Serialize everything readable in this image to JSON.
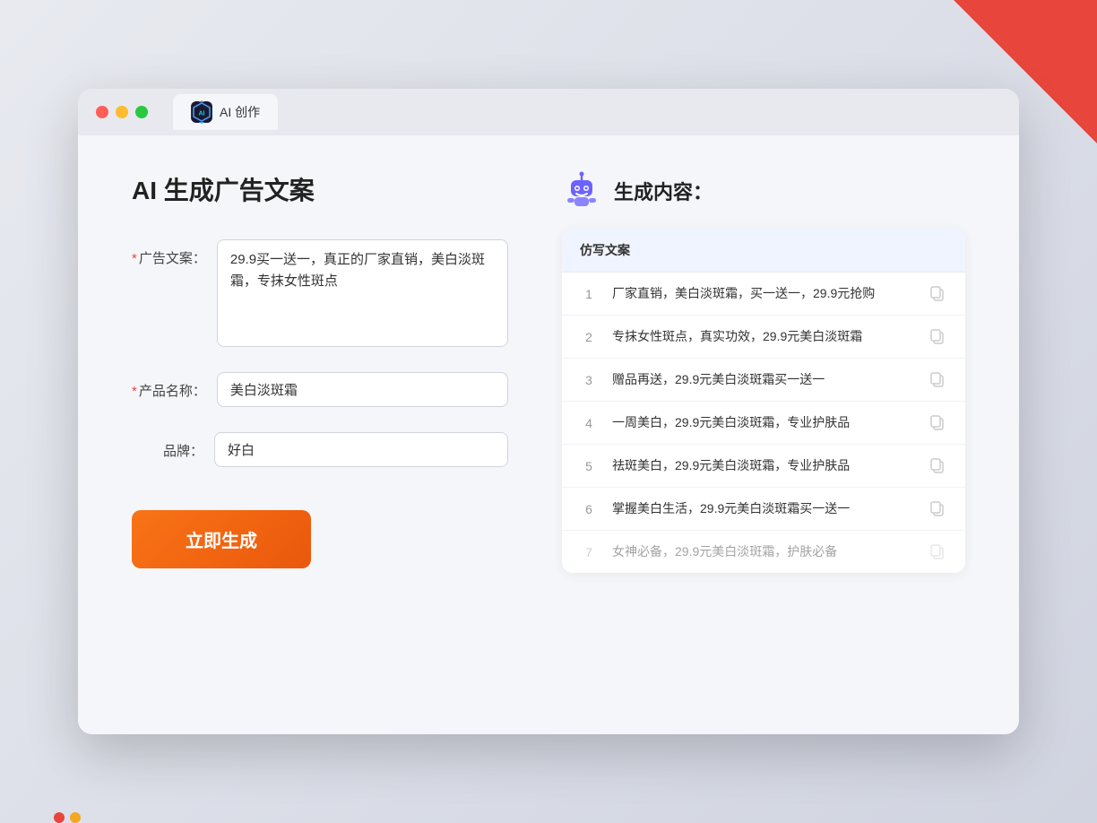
{
  "window": {
    "tab_label": "AI 创作",
    "ai_icon_text": "AI"
  },
  "left_panel": {
    "title": "AI 生成广告文案",
    "form": {
      "ad_copy_label": "广告文案：",
      "ad_copy_required": true,
      "ad_copy_value": "29.9买一送一，真正的厂家直销，美白淡斑霜，专抹女性斑点",
      "product_name_label": "产品名称：",
      "product_name_required": true,
      "product_name_value": "美白淡斑霜",
      "brand_label": "品牌：",
      "brand_required": false,
      "brand_value": "好白"
    },
    "generate_button": "立即生成"
  },
  "right_panel": {
    "title": "生成内容：",
    "column_header": "仿写文案",
    "results": [
      {
        "num": "1",
        "text": "厂家直销，美白淡斑霜，买一送一，29.9元抢购",
        "dim": false
      },
      {
        "num": "2",
        "text": "专抹女性斑点，真实功效，29.9元美白淡斑霜",
        "dim": false
      },
      {
        "num": "3",
        "text": "赠品再送，29.9元美白淡斑霜买一送一",
        "dim": false
      },
      {
        "num": "4",
        "text": "一周美白，29.9元美白淡斑霜，专业护肤品",
        "dim": false
      },
      {
        "num": "5",
        "text": "祛斑美白，29.9元美白淡斑霜，专业护肤品",
        "dim": false
      },
      {
        "num": "6",
        "text": "掌握美白生活，29.9元美白淡斑霜买一送一",
        "dim": false
      },
      {
        "num": "7",
        "text": "女神必备，29.9元美白淡斑霜，护肤必备",
        "dim": true
      }
    ]
  }
}
